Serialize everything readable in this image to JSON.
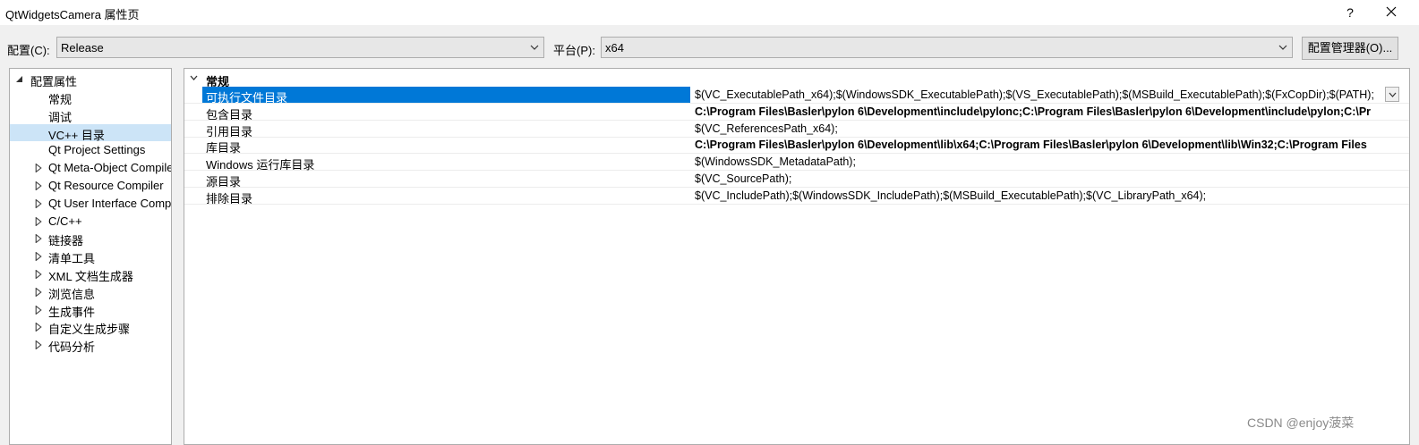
{
  "window": {
    "title": "QtWidgetsCamera 属性页",
    "help": "?"
  },
  "toolbar": {
    "config_label": "配置(C):",
    "config_value": "Release",
    "platform_label": "平台(P):",
    "platform_value": "x64",
    "manager_button": "配置管理器(O)..."
  },
  "tree": {
    "root": "配置属性",
    "items": [
      {
        "label": "常规",
        "expandable": false
      },
      {
        "label": "调试",
        "expandable": false
      },
      {
        "label": "VC++ 目录",
        "expandable": false,
        "selected": true
      },
      {
        "label": "Qt Project Settings",
        "expandable": false
      },
      {
        "label": "Qt Meta-Object Compiler",
        "expandable": true
      },
      {
        "label": "Qt Resource Compiler",
        "expandable": true
      },
      {
        "label": "Qt User Interface Compiler",
        "expandable": true
      },
      {
        "label": "C/C++",
        "expandable": true
      },
      {
        "label": "链接器",
        "expandable": true
      },
      {
        "label": "清单工具",
        "expandable": true
      },
      {
        "label": "XML 文档生成器",
        "expandable": true
      },
      {
        "label": "浏览信息",
        "expandable": true
      },
      {
        "label": "生成事件",
        "expandable": true
      },
      {
        "label": "自定义生成步骤",
        "expandable": true
      },
      {
        "label": "代码分析",
        "expandable": true
      }
    ]
  },
  "grid": {
    "category": "常规",
    "properties": [
      {
        "name": "可执行文件目录",
        "value": "$(VC_ExecutablePath_x64);$(WindowsSDK_ExecutablePath);$(VS_ExecutablePath);$(MSBuild_ExecutablePath);$(FxCopDir);$(PATH);",
        "bold": false,
        "selected": true
      },
      {
        "name": "包含目录",
        "value": "C:\\Program Files\\Basler\\pylon 6\\Development\\include\\pylonc;C:\\Program Files\\Basler\\pylon 6\\Development\\include\\pylon;C:\\Pr",
        "bold": true
      },
      {
        "name": "引用目录",
        "value": "$(VC_ReferencesPath_x64);",
        "bold": false
      },
      {
        "name": "库目录",
        "value": "C:\\Program Files\\Basler\\pylon 6\\Development\\lib\\x64;C:\\Program Files\\Basler\\pylon 6\\Development\\lib\\Win32;C:\\Program Files",
        "bold": true
      },
      {
        "name": "Windows 运行库目录",
        "value": "$(WindowsSDK_MetadataPath);",
        "bold": false
      },
      {
        "name": "源目录",
        "value": "$(VC_SourcePath);",
        "bold": false
      },
      {
        "name": "排除目录",
        "value": "$(VC_IncludePath);$(WindowsSDK_IncludePath);$(MSBuild_ExecutablePath);$(VC_LibraryPath_x64);",
        "bold": false
      }
    ]
  },
  "watermark": "CSDN @enjoy菠菜",
  "colors": {
    "selection_blue": "#0078d7",
    "tree_selection": "#cce4f7",
    "background": "#f0f0f0"
  }
}
